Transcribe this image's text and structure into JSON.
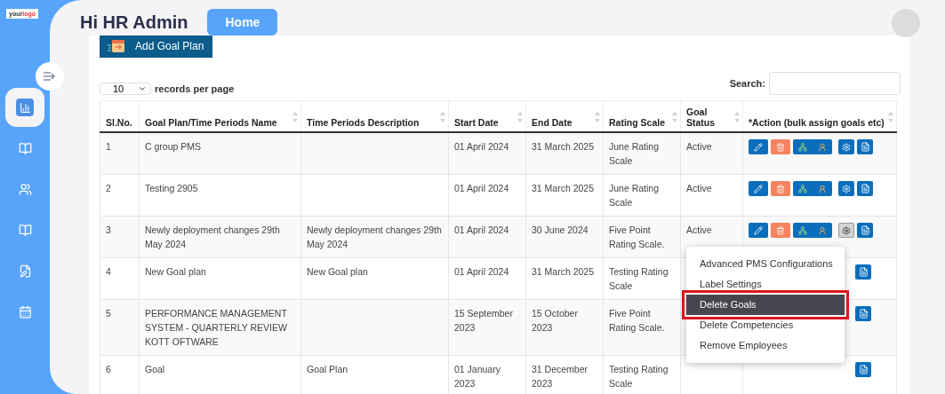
{
  "logo": {
    "part_1": "your",
    "part_2": "logo"
  },
  "sidebar": {
    "items": [
      {
        "kind": "chart",
        "selected": true
      },
      {
        "kind": "book",
        "selected": false
      },
      {
        "kind": "users",
        "selected": false
      },
      {
        "kind": "book",
        "selected": false
      },
      {
        "kind": "edit",
        "selected": false
      },
      {
        "kind": "calendar",
        "selected": false
      }
    ]
  },
  "header": {
    "greeting": "Hi HR Admin",
    "home_button": "Home"
  },
  "add_button": "Add Goal Plan",
  "page_size": {
    "value": "10",
    "label": "records per page"
  },
  "search": {
    "label": "Search:"
  },
  "table": {
    "columns": [
      "Sl.No.",
      "Goal Plan/Time Periods Name",
      "Time Periods Description",
      "Start Date",
      "End Date",
      "Rating Scale",
      "Goal Status",
      "*Action (bulk assign goals etc)"
    ],
    "rows": [
      {
        "no": "1",
        "name": "C group PMS",
        "description": "",
        "start": "01 April 2024",
        "end": "31 March 2025",
        "rating": "June Rating Scale",
        "status": "Active",
        "actions": [
          {
            "kind": "edit"
          },
          {
            "kind": "delete"
          },
          {
            "kind": "assign"
          },
          {
            "kind": "settings"
          },
          {
            "kind": "document"
          }
        ],
        "settings_open": false
      },
      {
        "no": "2",
        "name": "Testing 2905",
        "description": "",
        "start": "01 April 2024",
        "end": "31 March 2025",
        "rating": "June Rating Scale",
        "status": "Active",
        "actions": [
          {
            "kind": "edit"
          },
          {
            "kind": "delete"
          },
          {
            "kind": "assign"
          },
          {
            "kind": "settings"
          },
          {
            "kind": "document"
          }
        ],
        "settings_open": false
      },
      {
        "no": "3",
        "name": "Newly deployment changes 29th May 2024",
        "description": "Newly deployment changes 29th May 2024",
        "start": "01 April 2024",
        "end": "30 June 2024",
        "rating": "Five Point Rating Scale.",
        "status": "Active",
        "actions": [
          {
            "kind": "edit"
          },
          {
            "kind": "delete"
          },
          {
            "kind": "assign"
          },
          {
            "kind": "settings"
          },
          {
            "kind": "document"
          }
        ],
        "settings_open": true
      },
      {
        "no": "4",
        "name": "New Goal plan",
        "description": "New Goal plan",
        "start": "01 April 2024",
        "end": "31 March 2025",
        "rating": "Testing Rating Scale",
        "actions": [
          {
            "kind": "document"
          }
        ]
      },
      {
        "no": "5",
        "name": "PERFORMANCE MANAGEMENT SYSTEM - QUARTERLY REVIEW KOTT OFTWARE",
        "description": "",
        "start": "15 September 2023",
        "end": "15 October 2023",
        "rating": "Five Point Rating Scale.",
        "actions": [
          {
            "kind": "document"
          }
        ]
      },
      {
        "no": "6",
        "name": "Goal",
        "description": "Goal Plan",
        "start": "01 January 2023",
        "end": "31 December 2023",
        "rating": "Testing Rating Scale",
        "actions": [
          {
            "kind": "document"
          }
        ]
      }
    ]
  },
  "settings_menu": {
    "items": [
      {
        "label": "Advanced PMS Configurations",
        "selected": false
      },
      {
        "label": "Label Settings",
        "selected": false
      },
      {
        "label": "Delete Goals",
        "selected": true
      },
      {
        "label": "Delete Competencies",
        "selected": false
      },
      {
        "label": "Remove Employees",
        "selected": false
      }
    ]
  }
}
